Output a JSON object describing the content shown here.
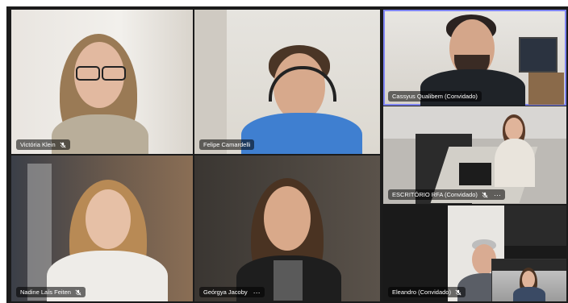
{
  "participants": [
    {
      "name": "Victória Klein",
      "muted": true
    },
    {
      "name": "Felipe Camardelli",
      "muted": false
    },
    {
      "name": "Cassyus Qualibem (Convidado)",
      "muted": false,
      "active_speaker": true
    },
    {
      "name": "ESCRITÓRIO RFA (Convidado)",
      "muted": true,
      "more_options": "···"
    },
    {
      "name": "Nadine Laís Feiten",
      "muted": true
    },
    {
      "name": "Geórgya Jacoby",
      "muted": false,
      "more_options": "···"
    },
    {
      "name": "Eleandro (Convidado)",
      "muted": true
    }
  ],
  "icons": {
    "mic_muted": "mic-off-icon",
    "more": "more-options-icon"
  },
  "colors": {
    "active_border": "#7f85f5",
    "background": "#1b1b1b"
  }
}
